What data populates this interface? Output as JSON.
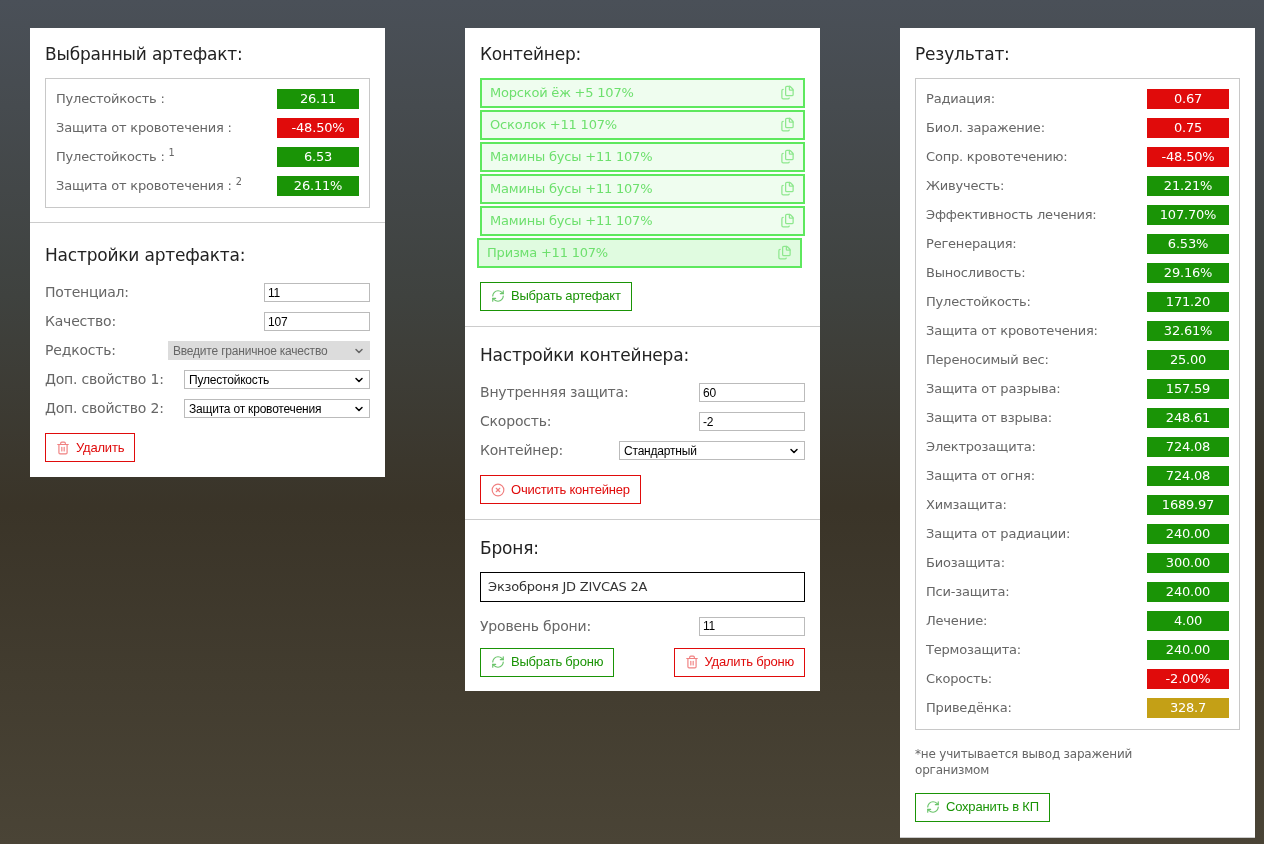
{
  "artifact": {
    "title": "Выбранный артефакт:",
    "stats": [
      {
        "label": "Пулестойкость :",
        "value": "26.11",
        "color": "#1a9406"
      },
      {
        "label": "Защита от кровотечения :",
        "value": "-48.50%",
        "color": "#e00b0b"
      },
      {
        "label": "Пулестойкость : $^{1}$",
        "value": "6.53",
        "color": "#1a9406"
      },
      {
        "label": "Защита от кровотечения : $^{2}$",
        "value": "26.11%",
        "color": "#1a9406"
      }
    ],
    "settings_title": "Настройки артефакта:",
    "fields": [
      {
        "kind": "input",
        "label": "Потенциал:",
        "value": "11"
      },
      {
        "kind": "input",
        "label": "Качество:",
        "value": "107"
      },
      {
        "kind": "select",
        "label": "Редкость:",
        "value": "Введите граничное качество",
        "disabled": true
      },
      {
        "kind": "select",
        "label": "Доп. свойство 1:",
        "value": "Пулестойкость",
        "disabled": false
      },
      {
        "kind": "select",
        "label": "Доп. свойство 2:",
        "value": "Защита от кровотечения",
        "disabled": false
      }
    ],
    "delete_button": "Удалить"
  },
  "container": {
    "title": "Контейнер:",
    "items": [
      {
        "label": "Морской ёж +5 107%",
        "selected": false
      },
      {
        "label": "Осколок +11 107%",
        "selected": false
      },
      {
        "label": "Мамины бусы +11 107%",
        "selected": false
      },
      {
        "label": "Мамины бусы +11 107%",
        "selected": false
      },
      {
        "label": "Мамины бусы +11 107%",
        "selected": false
      },
      {
        "label": "Призма +11 107%",
        "selected": true
      }
    ],
    "choose_button": "Выбрать артефакт",
    "settings_title": "Настройки контейнера:",
    "fields": [
      {
        "kind": "input",
        "label": "Внутренняя защита:",
        "value": "60"
      },
      {
        "kind": "input",
        "label": "Скорость:",
        "value": "-2"
      },
      {
        "kind": "select",
        "label": "Контейнер:",
        "value": "Стандартный",
        "disabled": false
      }
    ],
    "clear_button": "Очистить контейнер"
  },
  "armor": {
    "title": "Броня:",
    "name": "Экзоброня JD ZIVCAS 2A",
    "fields": [
      {
        "kind": "input",
        "label": "Уровень брони:",
        "value": "11"
      }
    ],
    "choose_button": "Выбрать броню",
    "delete_button": "Удалить броню"
  },
  "result": {
    "title": "Результат:",
    "stats": [
      {
        "label": "Радиация:",
        "value": "0.67",
        "color": "#e00b0b"
      },
      {
        "label": "Биол. заражение:",
        "value": "0.75",
        "color": "#e00b0b"
      },
      {
        "label": "Сопр. кровотечению:",
        "value": "-48.50%",
        "color": "#e00b0b"
      },
      {
        "label": "Живучесть:",
        "value": "21.21%",
        "color": "#1a9406"
      },
      {
        "label": "Эффективность лечения:",
        "value": "107.70%",
        "color": "#1a9406"
      },
      {
        "label": "Регенерация:",
        "value": "6.53%",
        "color": "#1a9406"
      },
      {
        "label": "Выносливость:",
        "value": "29.16%",
        "color": "#1a9406"
      },
      {
        "label": "Пулестойкость:",
        "value": "171.20",
        "color": "#1a9406"
      },
      {
        "label": "Защита от кровотечения:",
        "value": "32.61%",
        "color": "#1a9406"
      },
      {
        "label": "Переносимый вес:",
        "value": "25.00",
        "color": "#1a9406"
      },
      {
        "label": "Защита от разрыва:",
        "value": "157.59",
        "color": "#1a9406"
      },
      {
        "label": "Защита от взрыва:",
        "value": "248.61",
        "color": "#1a9406"
      },
      {
        "label": "Электрозащита:",
        "value": "724.08",
        "color": "#1a9406"
      },
      {
        "label": "Защита от огня:",
        "value": "724.08",
        "color": "#1a9406"
      },
      {
        "label": "Химзащита:",
        "value": "1689.97",
        "color": "#1a9406"
      },
      {
        "label": "Защита от радиации:",
        "value": "240.00",
        "color": "#1a9406"
      },
      {
        "label": "Биозащита:",
        "value": "300.00",
        "color": "#1a9406"
      },
      {
        "label": "Пси-защита:",
        "value": "240.00",
        "color": "#1a9406"
      },
      {
        "label": "Лечение:",
        "value": "4.00",
        "color": "#1a9406"
      },
      {
        "label": "Термозащита:",
        "value": "240.00",
        "color": "#1a9406"
      },
      {
        "label": "Скорость:",
        "value": "-2.00%",
        "color": "#e00b0b"
      },
      {
        "label": "Приведёнка:",
        "value": "328.7",
        "color": "#c4a016"
      }
    ],
    "note": "*не учитывается вывод заражений организмом",
    "save_button": "Сохранить в КП"
  }
}
